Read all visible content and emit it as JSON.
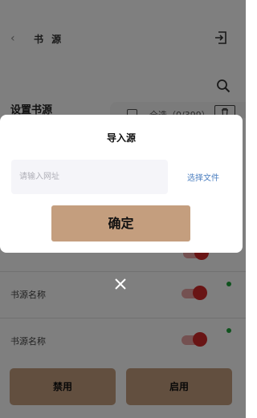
{
  "appbar": {
    "title": "书 源",
    "back_icon": "back-icon",
    "import_icon": "import-icon",
    "search_icon": "search-icon"
  },
  "settings": {
    "section_title": "设置书源",
    "select_all_label": "全选（0/399）"
  },
  "list": {
    "rows": [
      {
        "name": "书源名称",
        "enabled": true
      },
      {
        "name": "书源名称",
        "enabled": true
      }
    ]
  },
  "bottom": {
    "disable_label": "禁用",
    "enable_label": "启用"
  },
  "dialog": {
    "title": "导入源",
    "input_placeholder": "请输入网址",
    "choose_file_label": "选择文件",
    "confirm_label": "确定",
    "close_icon": "close-icon"
  },
  "colors": {
    "accent": "#c49e7e",
    "toggle_on": "#d32a2a",
    "status": "#1fa43a",
    "link": "#4c7fc0"
  }
}
